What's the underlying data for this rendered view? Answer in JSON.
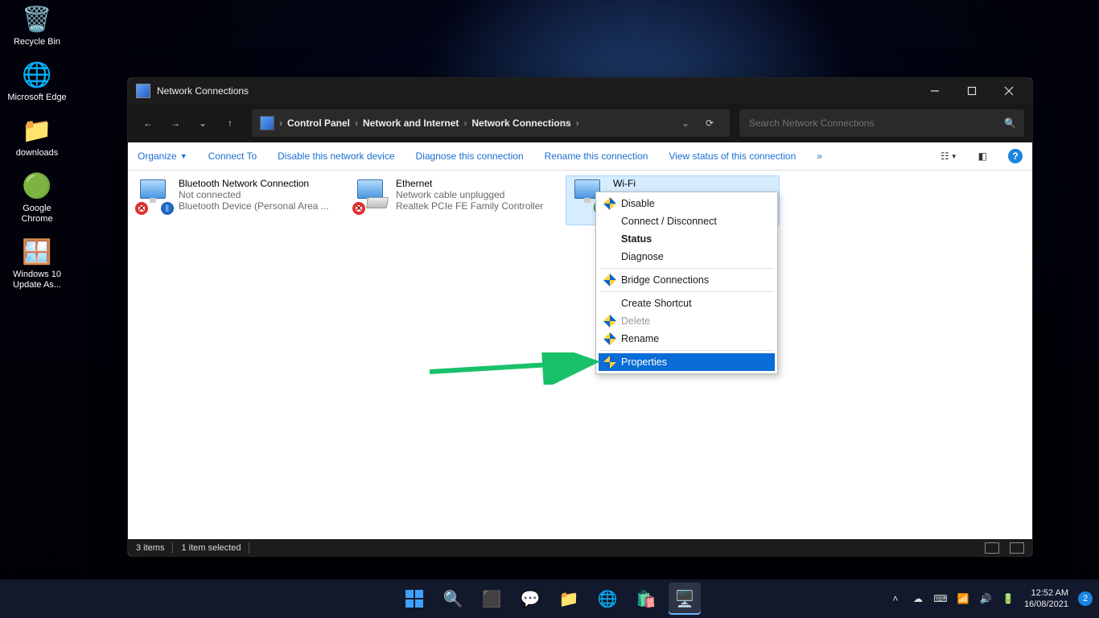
{
  "desktop": {
    "icons": [
      {
        "label": "Recycle Bin",
        "glyph": "🗑️"
      },
      {
        "label": "Microsoft Edge",
        "glyph": "🌐"
      },
      {
        "label": "downloads",
        "glyph": "📁"
      },
      {
        "label": "Google Chrome",
        "glyph": "🟢"
      },
      {
        "label": "Windows 10 Update As...",
        "glyph": "🪟"
      }
    ]
  },
  "window": {
    "title": "Network Connections",
    "breadcrumb": [
      "Control Panel",
      "Network and Internet",
      "Network Connections"
    ],
    "search_placeholder": "Search Network Connections",
    "command_bar": {
      "organize": "Organize",
      "items": [
        "Connect To",
        "Disable this network device",
        "Diagnose this connection",
        "Rename this connection",
        "View status of this connection"
      ],
      "overflow": "»"
    },
    "connections": [
      {
        "name": "Bluetooth Network Connection",
        "status": "Not connected",
        "device": "Bluetooth Device (Personal Area ...",
        "overlay": "bt_x",
        "selected": false
      },
      {
        "name": "Ethernet",
        "status": "Network cable unplugged",
        "device": "Realtek PCIe FE Family Controller",
        "overlay": "eth_x",
        "selected": false
      },
      {
        "name": "Wi-Fi",
        "status": "",
        "device": "",
        "overlay": "wifi",
        "selected": true
      }
    ],
    "context_menu": {
      "items": [
        {
          "label": "Disable",
          "shield": true
        },
        {
          "label": "Connect / Disconnect"
        },
        {
          "label": "Status",
          "bold": true
        },
        {
          "label": "Diagnose"
        },
        {
          "sep": true
        },
        {
          "label": "Bridge Connections",
          "shield": true
        },
        {
          "sep": true
        },
        {
          "label": "Create Shortcut"
        },
        {
          "label": "Delete",
          "shield": true,
          "disabled": true
        },
        {
          "label": "Rename",
          "shield": true
        },
        {
          "sep": true
        },
        {
          "label": "Properties",
          "shield": true,
          "highlight": true
        }
      ]
    },
    "status_bar": {
      "count": "3 items",
      "selected": "1 item selected"
    }
  },
  "taskbar": {
    "time": "12:52 AM",
    "date": "16/08/2021",
    "notifications": "2"
  }
}
